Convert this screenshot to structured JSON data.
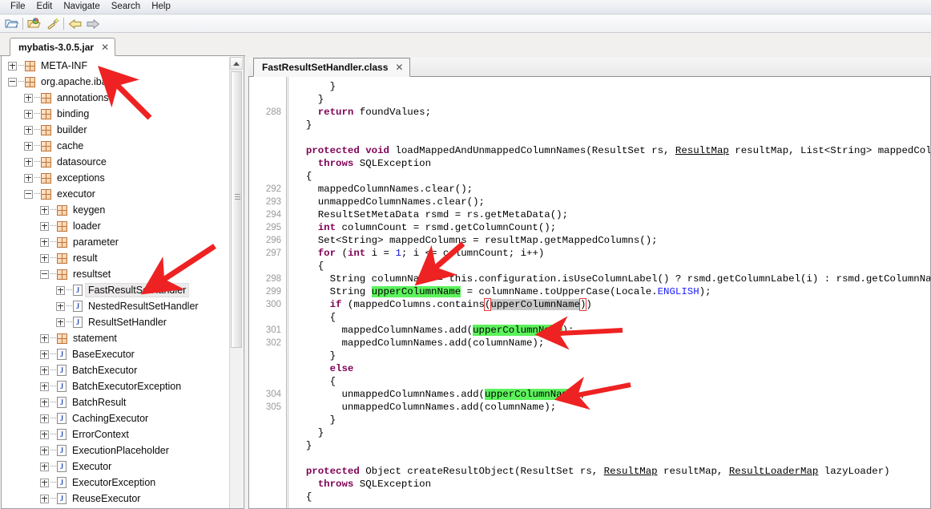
{
  "window": {
    "title": "mybatis-3.0.5.jar"
  },
  "menubar": {
    "items": [
      {
        "label": "File"
      },
      {
        "label": "Edit"
      },
      {
        "label": "Navigate"
      },
      {
        "label": "Search"
      },
      {
        "label": "Help"
      }
    ]
  },
  "toolbar": {
    "items": [
      {
        "name": "open-folder-icon",
        "title": "Open"
      },
      {
        "name": "open-jar-icon",
        "title": "Open Jar"
      },
      {
        "name": "magic-wand-icon",
        "title": "Decompile"
      },
      {
        "name": "back-arrow-icon",
        "title": "Back"
      },
      {
        "name": "forward-arrow-icon",
        "title": "Forward"
      }
    ]
  },
  "jar_tab": {
    "label": "mybatis-3.0.5.jar",
    "close": "✕"
  },
  "tree": {
    "nodes": [
      {
        "label": "META-INF",
        "depth": 0,
        "state": "collapsed",
        "icon": "package-icon"
      },
      {
        "label": "org.apache.ibatis",
        "depth": 0,
        "state": "expanded",
        "icon": "package-icon"
      },
      {
        "label": "annotations",
        "depth": 1,
        "state": "collapsed",
        "icon": "package-icon"
      },
      {
        "label": "binding",
        "depth": 1,
        "state": "collapsed",
        "icon": "package-icon"
      },
      {
        "label": "builder",
        "depth": 1,
        "state": "collapsed",
        "icon": "package-icon"
      },
      {
        "label": "cache",
        "depth": 1,
        "state": "collapsed",
        "icon": "package-icon"
      },
      {
        "label": "datasource",
        "depth": 1,
        "state": "collapsed",
        "icon": "package-icon"
      },
      {
        "label": "exceptions",
        "depth": 1,
        "state": "collapsed",
        "icon": "package-icon"
      },
      {
        "label": "executor",
        "depth": 1,
        "state": "expanded",
        "icon": "package-icon"
      },
      {
        "label": "keygen",
        "depth": 2,
        "state": "collapsed",
        "icon": "package-icon"
      },
      {
        "label": "loader",
        "depth": 2,
        "state": "collapsed",
        "icon": "package-icon"
      },
      {
        "label": "parameter",
        "depth": 2,
        "state": "collapsed",
        "icon": "package-icon"
      },
      {
        "label": "result",
        "depth": 2,
        "state": "collapsed",
        "icon": "package-icon"
      },
      {
        "label": "resultset",
        "depth": 2,
        "state": "expanded",
        "icon": "package-icon"
      },
      {
        "label": "FastResultSetHandler",
        "depth": 3,
        "state": "collapsed",
        "icon": "java-class-icon",
        "selected": true
      },
      {
        "label": "NestedResultSetHandler",
        "depth": 3,
        "state": "collapsed",
        "icon": "java-class-icon"
      },
      {
        "label": "ResultSetHandler",
        "depth": 3,
        "state": "collapsed",
        "icon": "java-class-icon"
      },
      {
        "label": "statement",
        "depth": 2,
        "state": "collapsed",
        "icon": "package-icon"
      },
      {
        "label": "BaseExecutor",
        "depth": 2,
        "state": "collapsed",
        "icon": "java-class-icon"
      },
      {
        "label": "BatchExecutor",
        "depth": 2,
        "state": "collapsed",
        "icon": "java-class-icon"
      },
      {
        "label": "BatchExecutorException",
        "depth": 2,
        "state": "collapsed",
        "icon": "java-class-icon"
      },
      {
        "label": "BatchResult",
        "depth": 2,
        "state": "collapsed",
        "icon": "java-class-icon"
      },
      {
        "label": "CachingExecutor",
        "depth": 2,
        "state": "collapsed",
        "icon": "java-class-icon"
      },
      {
        "label": "ErrorContext",
        "depth": 2,
        "state": "collapsed",
        "icon": "java-class-icon"
      },
      {
        "label": "ExecutionPlaceholder",
        "depth": 2,
        "state": "collapsed",
        "icon": "java-class-icon"
      },
      {
        "label": "Executor",
        "depth": 2,
        "state": "collapsed",
        "icon": "java-class-icon"
      },
      {
        "label": "ExecutorException",
        "depth": 2,
        "state": "collapsed",
        "icon": "java-class-icon"
      },
      {
        "label": "ReuseExecutor",
        "depth": 2,
        "state": "collapsed",
        "icon": "java-class-icon"
      }
    ]
  },
  "editor": {
    "tab": {
      "label": "FastResultSetHandler.class",
      "close": "✕"
    },
    "line_numbers": [
      "288",
      "292",
      "293",
      "294",
      "295",
      "296",
      "297",
      "298",
      "299",
      "300",
      "301",
      "302",
      "304",
      "305"
    ],
    "code_lines": [
      "      }",
      "    }",
      "    return foundValues;",
      "  }",
      "",
      "  protected void loadMappedAndUnmappedColumnNames(ResultSet rs, ResultMap resultMap, List<String> mappedColumnNames,",
      "    throws SQLException",
      "  {",
      "    mappedColumnNames.clear();",
      "    unmappedColumnNames.clear();",
      "    ResultSetMetaData rsmd = rs.getMetaData();",
      "    int columnCount = rsmd.getColumnCount();",
      "    Set<String> mappedColumns = resultMap.getMappedColumns();",
      "    for (int i = 1; i <= columnCount; i++)",
      "    {",
      "      String columnName = this.configuration.isUseColumnLabel() ? rsmd.getColumnLabel(i) : rsmd.getColumnName(i);",
      "      String upperColumnName = columnName.toUpperCase(Locale.ENGLISH);",
      "      if (mappedColumns.contains(upperColumnName))",
      "      {",
      "        mappedColumnNames.add(upperColumnName);",
      "        mappedColumnNames.add(columnName);",
      "      }",
      "      else",
      "      {",
      "        unmappedColumnNames.add(upperColumnName);",
      "        unmappedColumnNames.add(columnName);",
      "      }",
      "    }",
      "  }",
      "",
      "  protected Object createResultObject(ResultSet rs, ResultMap resultMap, ResultLoaderMap lazyLoader)",
      "    throws SQLException",
      "  {"
    ],
    "highlighted_token": "upperColumnName",
    "keywords": [
      "return",
      "protected",
      "void",
      "throws",
      "int",
      "for",
      "if",
      "else",
      "Object"
    ]
  },
  "annotations": {
    "arrow_color": "#ee2222",
    "arrows": [
      {
        "name": "arrow-to-jar-tab",
        "target": "mybatis-3.0.5.jar tab"
      },
      {
        "name": "arrow-to-fastresultsethandler",
        "target": "FastResultSetHandler tree node"
      },
      {
        "name": "arrow-to-line-298",
        "target": "columnName assignment line 298"
      },
      {
        "name": "arrow-to-line-301",
        "target": "mappedColumnNames.add(upperColumnName) line 301"
      },
      {
        "name": "arrow-to-line-304",
        "target": "unmappedColumnNames.add(upperColumnName) line 304"
      }
    ]
  },
  "colors": {
    "keyword": "#7f0055",
    "highlight_green": "#5cf25c",
    "selection_gray": "#c9c9c9",
    "arrow_red": "#ee2222",
    "constant_blue": "#1a1aff"
  }
}
